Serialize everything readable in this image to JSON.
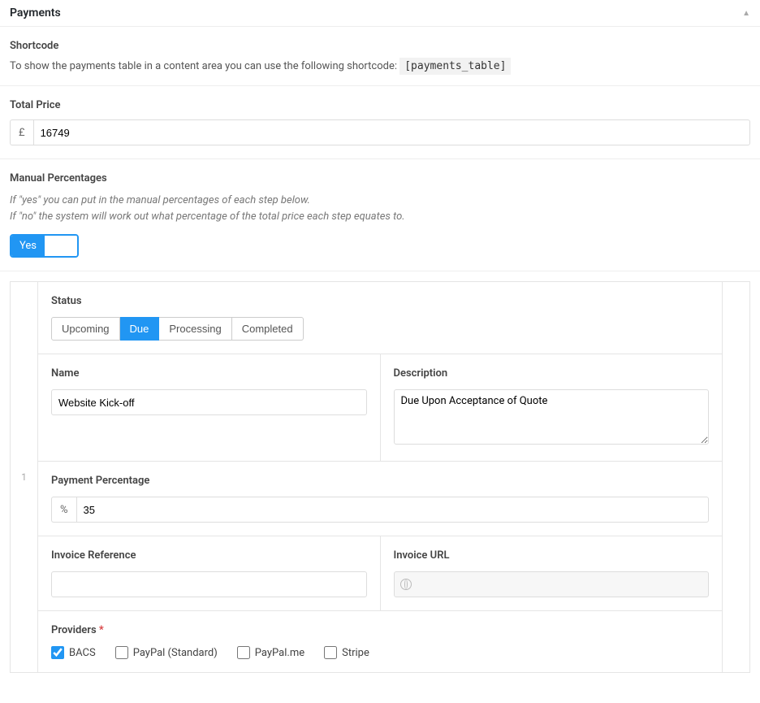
{
  "panel": {
    "title": "Payments"
  },
  "shortcode": {
    "label": "Shortcode",
    "text_before": "To show the payments table in a content area you can use the following shortcode: ",
    "code": "[payments_table]"
  },
  "total_price": {
    "label": "Total Price",
    "currency": "£",
    "value": "16749"
  },
  "manual_percentages": {
    "label": "Manual Percentages",
    "help_line1": "If \"yes\" you can put in the manual percentages of each step below.",
    "help_line2": "If \"no\" the system will work out what percentage of the total price each step equates to.",
    "toggle_yes": "Yes"
  },
  "repeater_index": "1",
  "status": {
    "label": "Status",
    "options": [
      "Upcoming",
      "Due",
      "Processing",
      "Completed"
    ],
    "active_index": 1
  },
  "name_field": {
    "label": "Name",
    "value": "Website Kick-off"
  },
  "description_field": {
    "label": "Description",
    "value": "Due Upon Acceptance of Quote"
  },
  "percentage": {
    "label": "Payment Percentage",
    "prefix": "%",
    "value": "35"
  },
  "invoice_ref": {
    "label": "Invoice Reference",
    "value": ""
  },
  "invoice_url": {
    "label": "Invoice URL",
    "value": ""
  },
  "providers": {
    "label": "Providers",
    "options": [
      {
        "label": "BACS",
        "checked": true
      },
      {
        "label": "PayPal (Standard)",
        "checked": false
      },
      {
        "label": "PayPal.me",
        "checked": false
      },
      {
        "label": "Stripe",
        "checked": false
      }
    ]
  }
}
